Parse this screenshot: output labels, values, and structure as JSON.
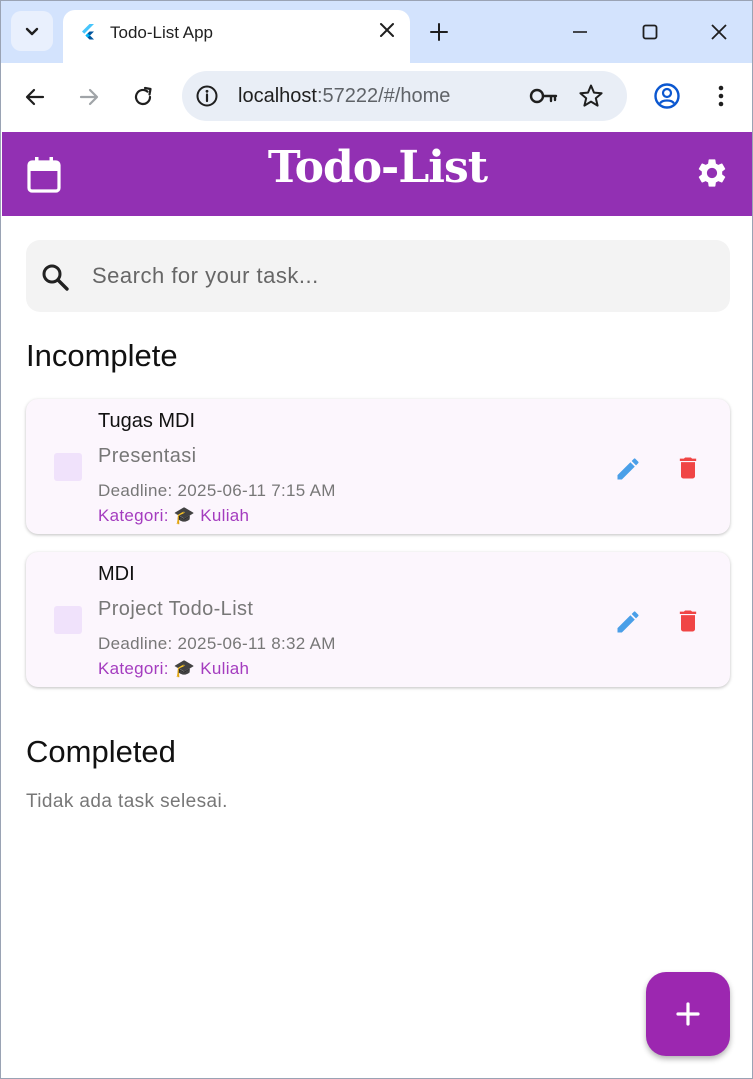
{
  "browser": {
    "tab_title": "Todo-List App",
    "url_host": "localhost",
    "url_rest": ":57222/#/home"
  },
  "app": {
    "title": "Todo-List",
    "accent": "#9230b3",
    "search_placeholder": "Search for your task..."
  },
  "incomplete": {
    "heading": "Incomplete",
    "tasks": [
      {
        "title": "Tugas MDI",
        "description": "Presentasi",
        "deadline": "Deadline: 2025-06-11 7:15 AM",
        "category": "Kategori: 🎓 Kuliah"
      },
      {
        "title": "MDI",
        "description": "Project Todo-List",
        "deadline": "Deadline: 2025-06-11 8:32 AM",
        "category": "Kategori: 🎓 Kuliah"
      }
    ]
  },
  "completed": {
    "heading": "Completed",
    "empty_text": "Tidak ada task selesai."
  },
  "icons": {
    "edit_color": "#4a9fe8",
    "delete_color": "#f04545"
  }
}
